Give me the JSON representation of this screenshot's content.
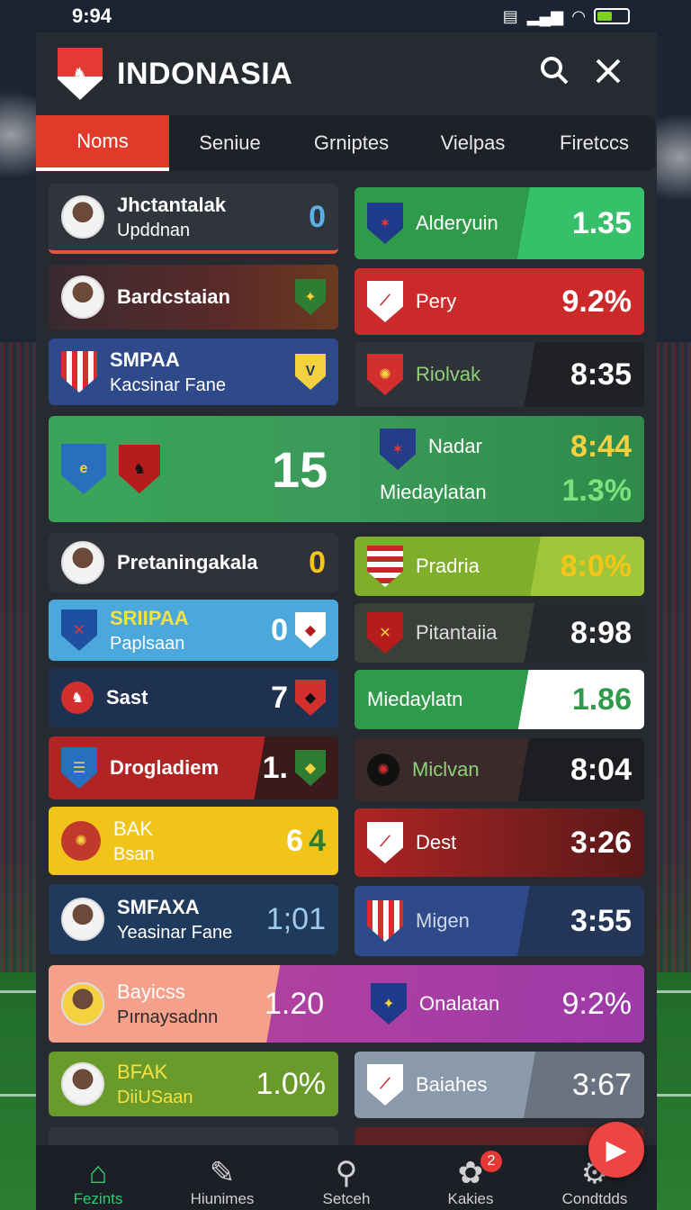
{
  "status": {
    "time": "9:94"
  },
  "header": {
    "title": "INDONASIA",
    "search_icon": "search-icon",
    "close_icon": "close-icon"
  },
  "tabs": [
    {
      "label": "Noms",
      "active": true
    },
    {
      "label": "Seniue"
    },
    {
      "label": "Grniptes"
    },
    {
      "label": "Vielpas"
    },
    {
      "label": "Firetccs"
    }
  ],
  "left_cards": [
    {
      "name": "Jhctantalak",
      "sub": "Upddnan",
      "value": "0"
    },
    {
      "name": "Bardcstaian",
      "sub": "",
      "value": ""
    },
    {
      "name": "SMPAA",
      "sub": "Kacsinar Fane",
      "value": ""
    },
    {
      "name": "",
      "sub": "",
      "value": "15"
    },
    {
      "name": "Pretaningakala",
      "sub": "",
      "value": "0"
    },
    {
      "name": "SRIIPAA",
      "sub": "Paplsaan",
      "value": "0"
    },
    {
      "name": "Sast",
      "sub": "",
      "value": "7"
    },
    {
      "name": "Drogladiem",
      "sub": "",
      "value": "1."
    },
    {
      "name": "BAK",
      "sub": "Bsan",
      "value": "6"
    },
    {
      "name": "SMFAXA",
      "sub": "Yeasinar Fane",
      "value": "1;01"
    },
    {
      "name": "Bayicss",
      "sub": "Pırnaysadnn",
      "value": "1.20"
    },
    {
      "name": "BFAK",
      "sub": "DiiUSaan",
      "value": "1.0%"
    }
  ],
  "right_cards": [
    {
      "name": "Alderyuin",
      "sub": "",
      "value": "1.35"
    },
    {
      "name": "Pery",
      "sub": "",
      "value": "9.2%"
    },
    {
      "name": "Riolvak",
      "sub": "",
      "value": "8:35"
    },
    {
      "name": "Nadar",
      "sub": "Miedaylatan",
      "value": "8:44",
      "value2": "1.3%"
    },
    {
      "name": "Pradria",
      "sub": "",
      "value": "8:0%"
    },
    {
      "name": "Pitantaiia",
      "sub": "",
      "value": "8:98"
    },
    {
      "name": "Miedaylatn",
      "sub": "",
      "value": "1.86"
    },
    {
      "name": "Miclvan",
      "sub": "",
      "value": "8:04"
    },
    {
      "name": "Dest",
      "sub": "",
      "value": "3:26"
    },
    {
      "name": "Migen",
      "sub": "",
      "value": "3:55"
    },
    {
      "name": "Onalatan",
      "sub": "",
      "value": "9:2%"
    },
    {
      "name": "Baiahes",
      "sub": "",
      "value": "3:67"
    }
  ],
  "bottom_nav": [
    {
      "label": "Fezints",
      "icon": "home-icon",
      "active": true
    },
    {
      "label": "Hiunimes",
      "icon": "edit-icon"
    },
    {
      "label": "Setceh",
      "icon": "search-icon"
    },
    {
      "label": "Kakies",
      "icon": "cookie-icon",
      "badge": "2"
    },
    {
      "label": "Condtdds",
      "icon": "settings-icon"
    }
  ],
  "colors": {
    "active_tab": "#e23a2a",
    "nav_active": "#2ecc71",
    "fab": "#ef4444"
  }
}
